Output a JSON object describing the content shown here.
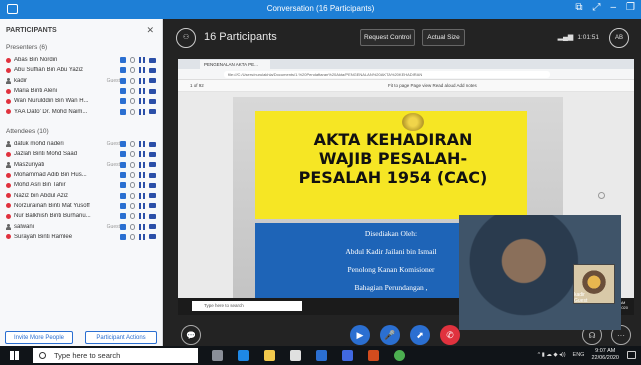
{
  "window": {
    "title": "Conversation (16 Participants)"
  },
  "panel": {
    "heading": "PARTICIPANTS",
    "presenters_label": "Presenters (6)",
    "attendees_label": "Attendees (10)",
    "presenters": [
      {
        "name": "Abas Bin Nordin",
        "guest": "",
        "type": "dot",
        "color": "#e0323e"
      },
      {
        "name": "Abu Suffian Bin Abu Yaziz",
        "guest": "",
        "type": "dot",
        "color": "#e0323e"
      },
      {
        "name": "kadir",
        "guest": "Guest",
        "type": "person",
        "color": "#666666"
      },
      {
        "name": "Maria Binti Aleni",
        "guest": "",
        "type": "dot",
        "color": "#e0323e"
      },
      {
        "name": "Wan Nurulddin Bin Wan H...",
        "guest": "",
        "type": "dot",
        "color": "#e0323e"
      },
      {
        "name": "YAA Dato' Dr. Mohd Naim...",
        "guest": "",
        "type": "dot",
        "color": "#e0323e"
      }
    ],
    "attendees": [
      {
        "name": "datuk mohd naderi",
        "guest": "Guest",
        "type": "person",
        "color": "#666666"
      },
      {
        "name": "Jazlah Binti Mohd Saad",
        "guest": "",
        "type": "dot",
        "color": "#e0323e"
      },
      {
        "name": "Maszuriyati",
        "guest": "Guest",
        "type": "person",
        "color": "#666666"
      },
      {
        "name": "Mohammad Adib Bin Hus...",
        "guest": "",
        "type": "dot",
        "color": "#e0323e"
      },
      {
        "name": "Mohd Asri Bin Tahir",
        "guest": "",
        "type": "dot",
        "color": "#e0323e"
      },
      {
        "name": "Naziz bin Abdul Aziz",
        "guest": "",
        "type": "dot",
        "color": "#e0323e"
      },
      {
        "name": "Norzurainah Binti Mat Yusoff",
        "guest": "",
        "type": "dot",
        "color": "#e0323e"
      },
      {
        "name": "Nur Balkhish Binti Burhanu...",
        "guest": "",
        "type": "dot",
        "color": "#e0323e"
      },
      {
        "name": "salwani",
        "guest": "Guest",
        "type": "person",
        "color": "#666666"
      },
      {
        "name": "Surayah Binti Ramlee",
        "guest": "",
        "type": "dot",
        "color": "#e0323e"
      }
    ],
    "invite_label": "Invite More People",
    "actions_label": "Participant Actions"
  },
  "meeting": {
    "participants_text": "16 Participants",
    "request_control_label": "Request Control",
    "actual_size_label": "Actual Size",
    "call_time": "1:01:51"
  },
  "browser": {
    "tab_title": "PENGENALAN AKTA PE...",
    "url": "file:///C:/Users/nurulakhla/Documents/1.%20Pendaftaran%20Akta/PENGENALAN%20AKTA%20KEHADIRAN",
    "page_indicator": "1  of 92",
    "pdf_tools": "Fit to page   Page view   Read aloud   Add notes"
  },
  "slide": {
    "title_lines": [
      "AKTA KEHADIRAN",
      "WAJIB PESALAH-",
      "PESALAH 1954 (CAC)"
    ],
    "byline": [
      "Disediakan Oleh:",
      "Abdul Kadir Jailani bin Ismail",
      "Penolong Kanan Komisioner",
      "Bahagian Perundangan ,"
    ]
  },
  "video": {
    "inner_label": "kadir",
    "inner_sub": "Guest"
  },
  "inner_taskbar": {
    "search_placeholder": "Type here to search",
    "time": "9:07 AM",
    "date": "22/06/2020"
  },
  "taskbar": {
    "search_placeholder": "Type here to search",
    "lang": "ENG",
    "time": "9:07 AM",
    "date": "22/06/2020"
  },
  "colors": {
    "accent": "#2b6fd1",
    "hangup": "#e0323e",
    "titlebar": "#1e7fd6",
    "slide_yellow": "#f6e624",
    "slide_blue": "#1e64b7"
  }
}
